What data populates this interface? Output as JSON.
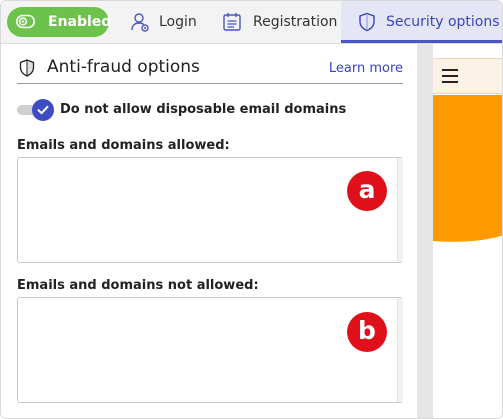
{
  "tabs": {
    "enabled_label": "Enabled",
    "login_label": "Login",
    "registration_label": "Registration",
    "security_label": "Security options",
    "active": "security"
  },
  "section": {
    "title": "Anti-fraud options",
    "learn_more": "Learn more"
  },
  "toggle": {
    "label": "Do not allow disposable email domains",
    "checked": true
  },
  "fields": {
    "allowed_label": "Emails and domains allowed:",
    "allowed_value": "",
    "not_allowed_label": "Emails and domains not allowed:",
    "not_allowed_value": ""
  },
  "annotations": {
    "a": "a",
    "b": "b"
  },
  "colors": {
    "enabled_green": "#6cc24a",
    "accent_blue": "#3f4bc2",
    "active_tab_bg": "#e4e6f6",
    "badge_red": "#e0101b",
    "preview_orange": "#ff9900"
  },
  "icons": {
    "enabled": "toggle-eye-icon",
    "login": "user-icon",
    "registration": "calendar-form-icon",
    "security": "shield-icon",
    "section": "shield-icon",
    "menu": "hamburger-icon"
  }
}
